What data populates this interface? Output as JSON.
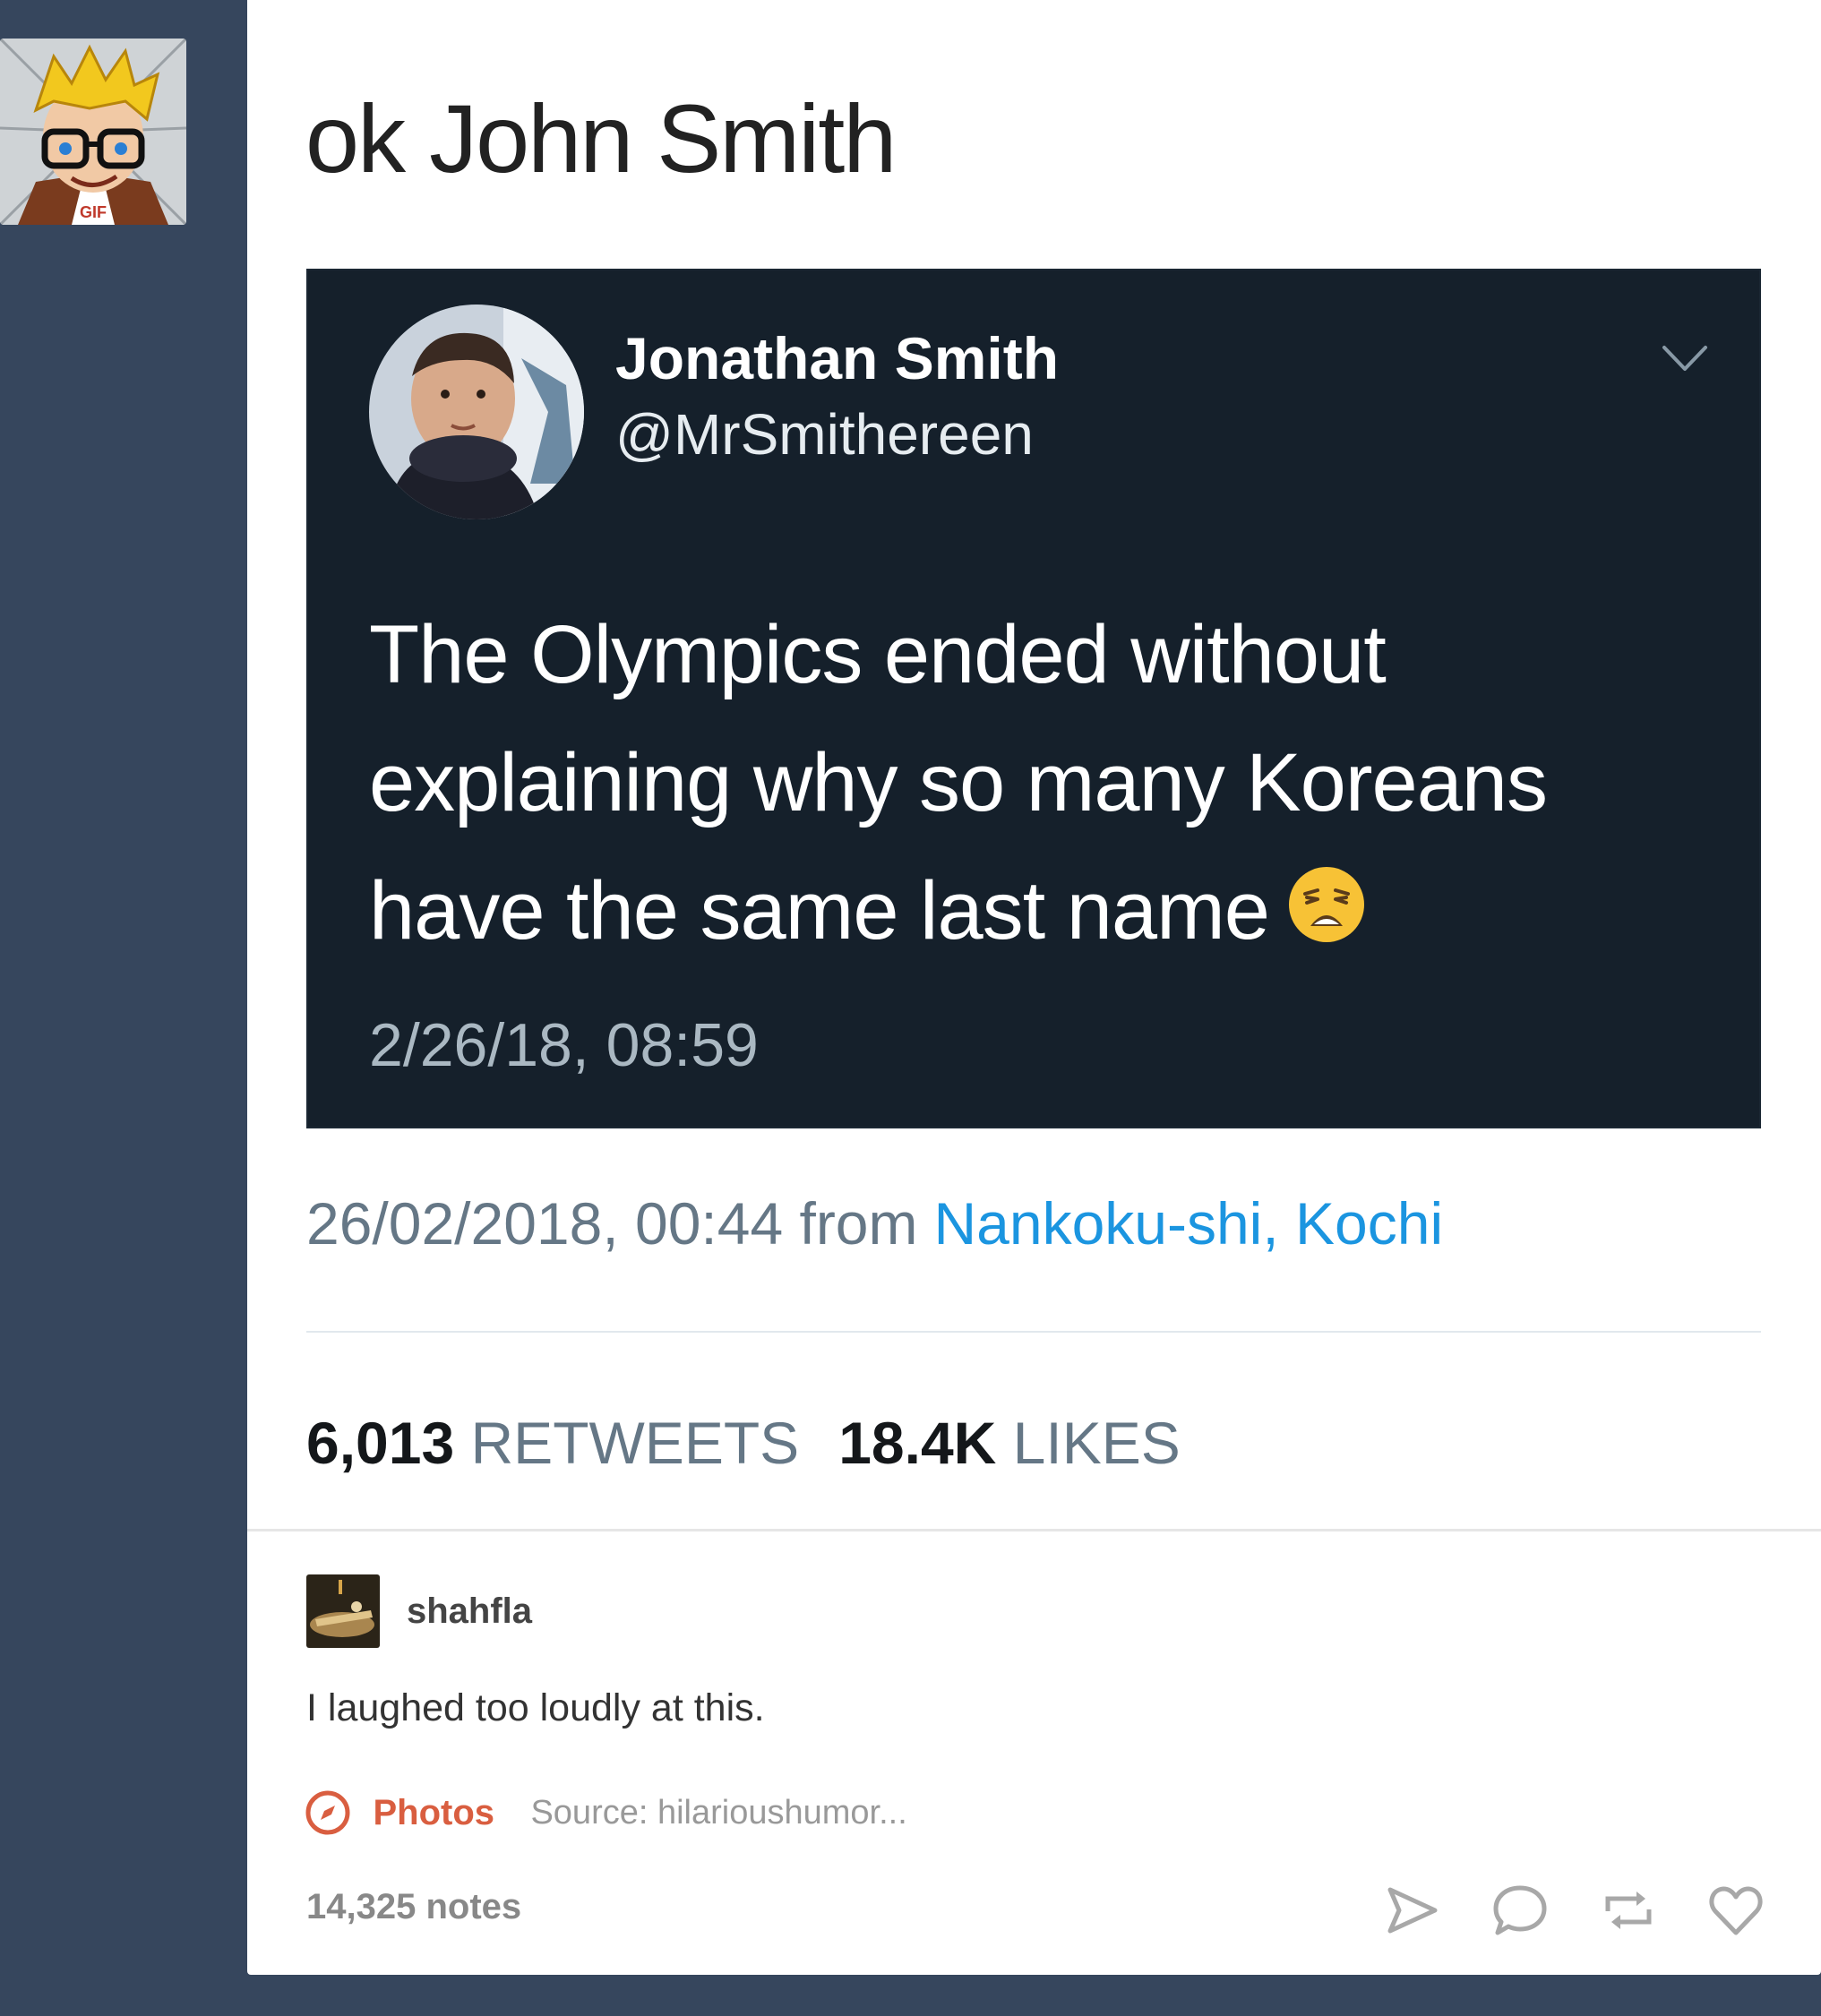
{
  "post": {
    "title": "ok John Smith",
    "tweet": {
      "display_name": "Jonathan Smith",
      "handle": "@MrSmithereen",
      "text_lines": [
        "The Olympics ended without",
        "explaining why so many Koreans",
        "have the same last name"
      ],
      "emoji": "weary-face-emoji",
      "timestamp": "2/26/18, 08:59"
    },
    "posted": {
      "datetime": "26/02/2018, 00:44 from",
      "location": "Nankoku-shi, Kochi"
    },
    "stats": {
      "retweets_count": "6,013",
      "retweets_label": "RETWEETS",
      "likes_count": "18.4K",
      "likes_label": "LIKES"
    },
    "reblog": {
      "username": "shahfla",
      "comment": "I laughed too loudly at this."
    },
    "footer": {
      "tag_label": "Photos",
      "source": "Source: hilarioushumor...",
      "notes": "14,325 notes",
      "icons": [
        "share-icon",
        "reply-icon",
        "reblog-icon",
        "like-icon"
      ]
    }
  },
  "colors": {
    "dashboard_background": "#36465d",
    "tweet_background": "#15202b",
    "link_blue": "#1b95e0",
    "tag_accent": "#d95e40"
  }
}
